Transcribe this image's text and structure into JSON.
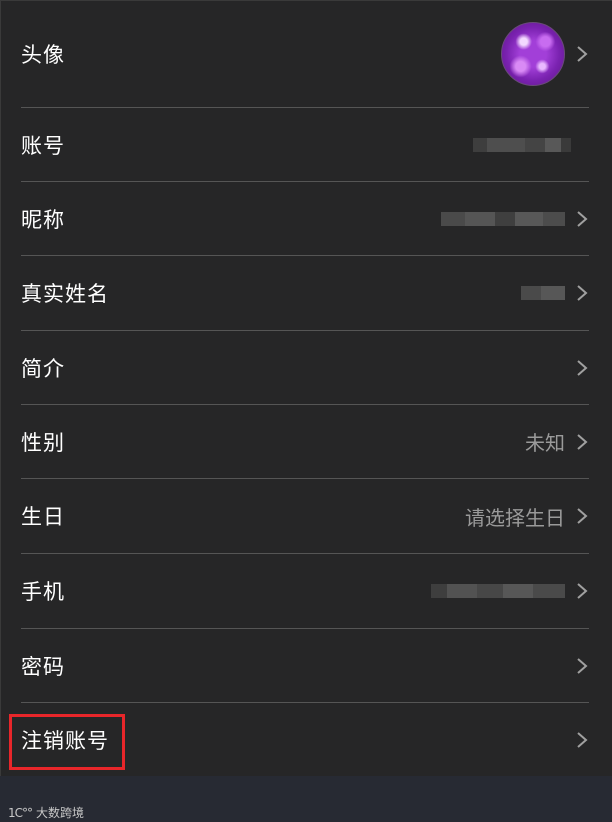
{
  "rows": [
    {
      "label": "头像",
      "value": "",
      "kind": "avatar"
    },
    {
      "label": "账号",
      "value": "",
      "kind": "blurred"
    },
    {
      "label": "昵称",
      "value": "",
      "kind": "blurred"
    },
    {
      "label": "真实姓名",
      "value": "",
      "kind": "blurred"
    },
    {
      "label": "简介",
      "value": "",
      "kind": "plain"
    },
    {
      "label": "性别",
      "value": "未知",
      "kind": "plain"
    },
    {
      "label": "生日",
      "value": "请选择生日",
      "kind": "plain"
    },
    {
      "label": "手机",
      "value": "",
      "kind": "blurred"
    },
    {
      "label": "密码",
      "value": "",
      "kind": "plain"
    },
    {
      "label": "注销账号",
      "value": "",
      "kind": "plain"
    }
  ],
  "footer": {
    "brand": "大数跨境",
    "mark": "1C°°"
  },
  "colors": {
    "background": "#262627",
    "divider": "#555555",
    "label": "#ffffff",
    "value": "#9a9a9a",
    "highlight": "#e8262a",
    "footer": "#272a33"
  },
  "icons": {
    "chevron": "chevron-right-icon",
    "avatar": "user-avatar"
  }
}
